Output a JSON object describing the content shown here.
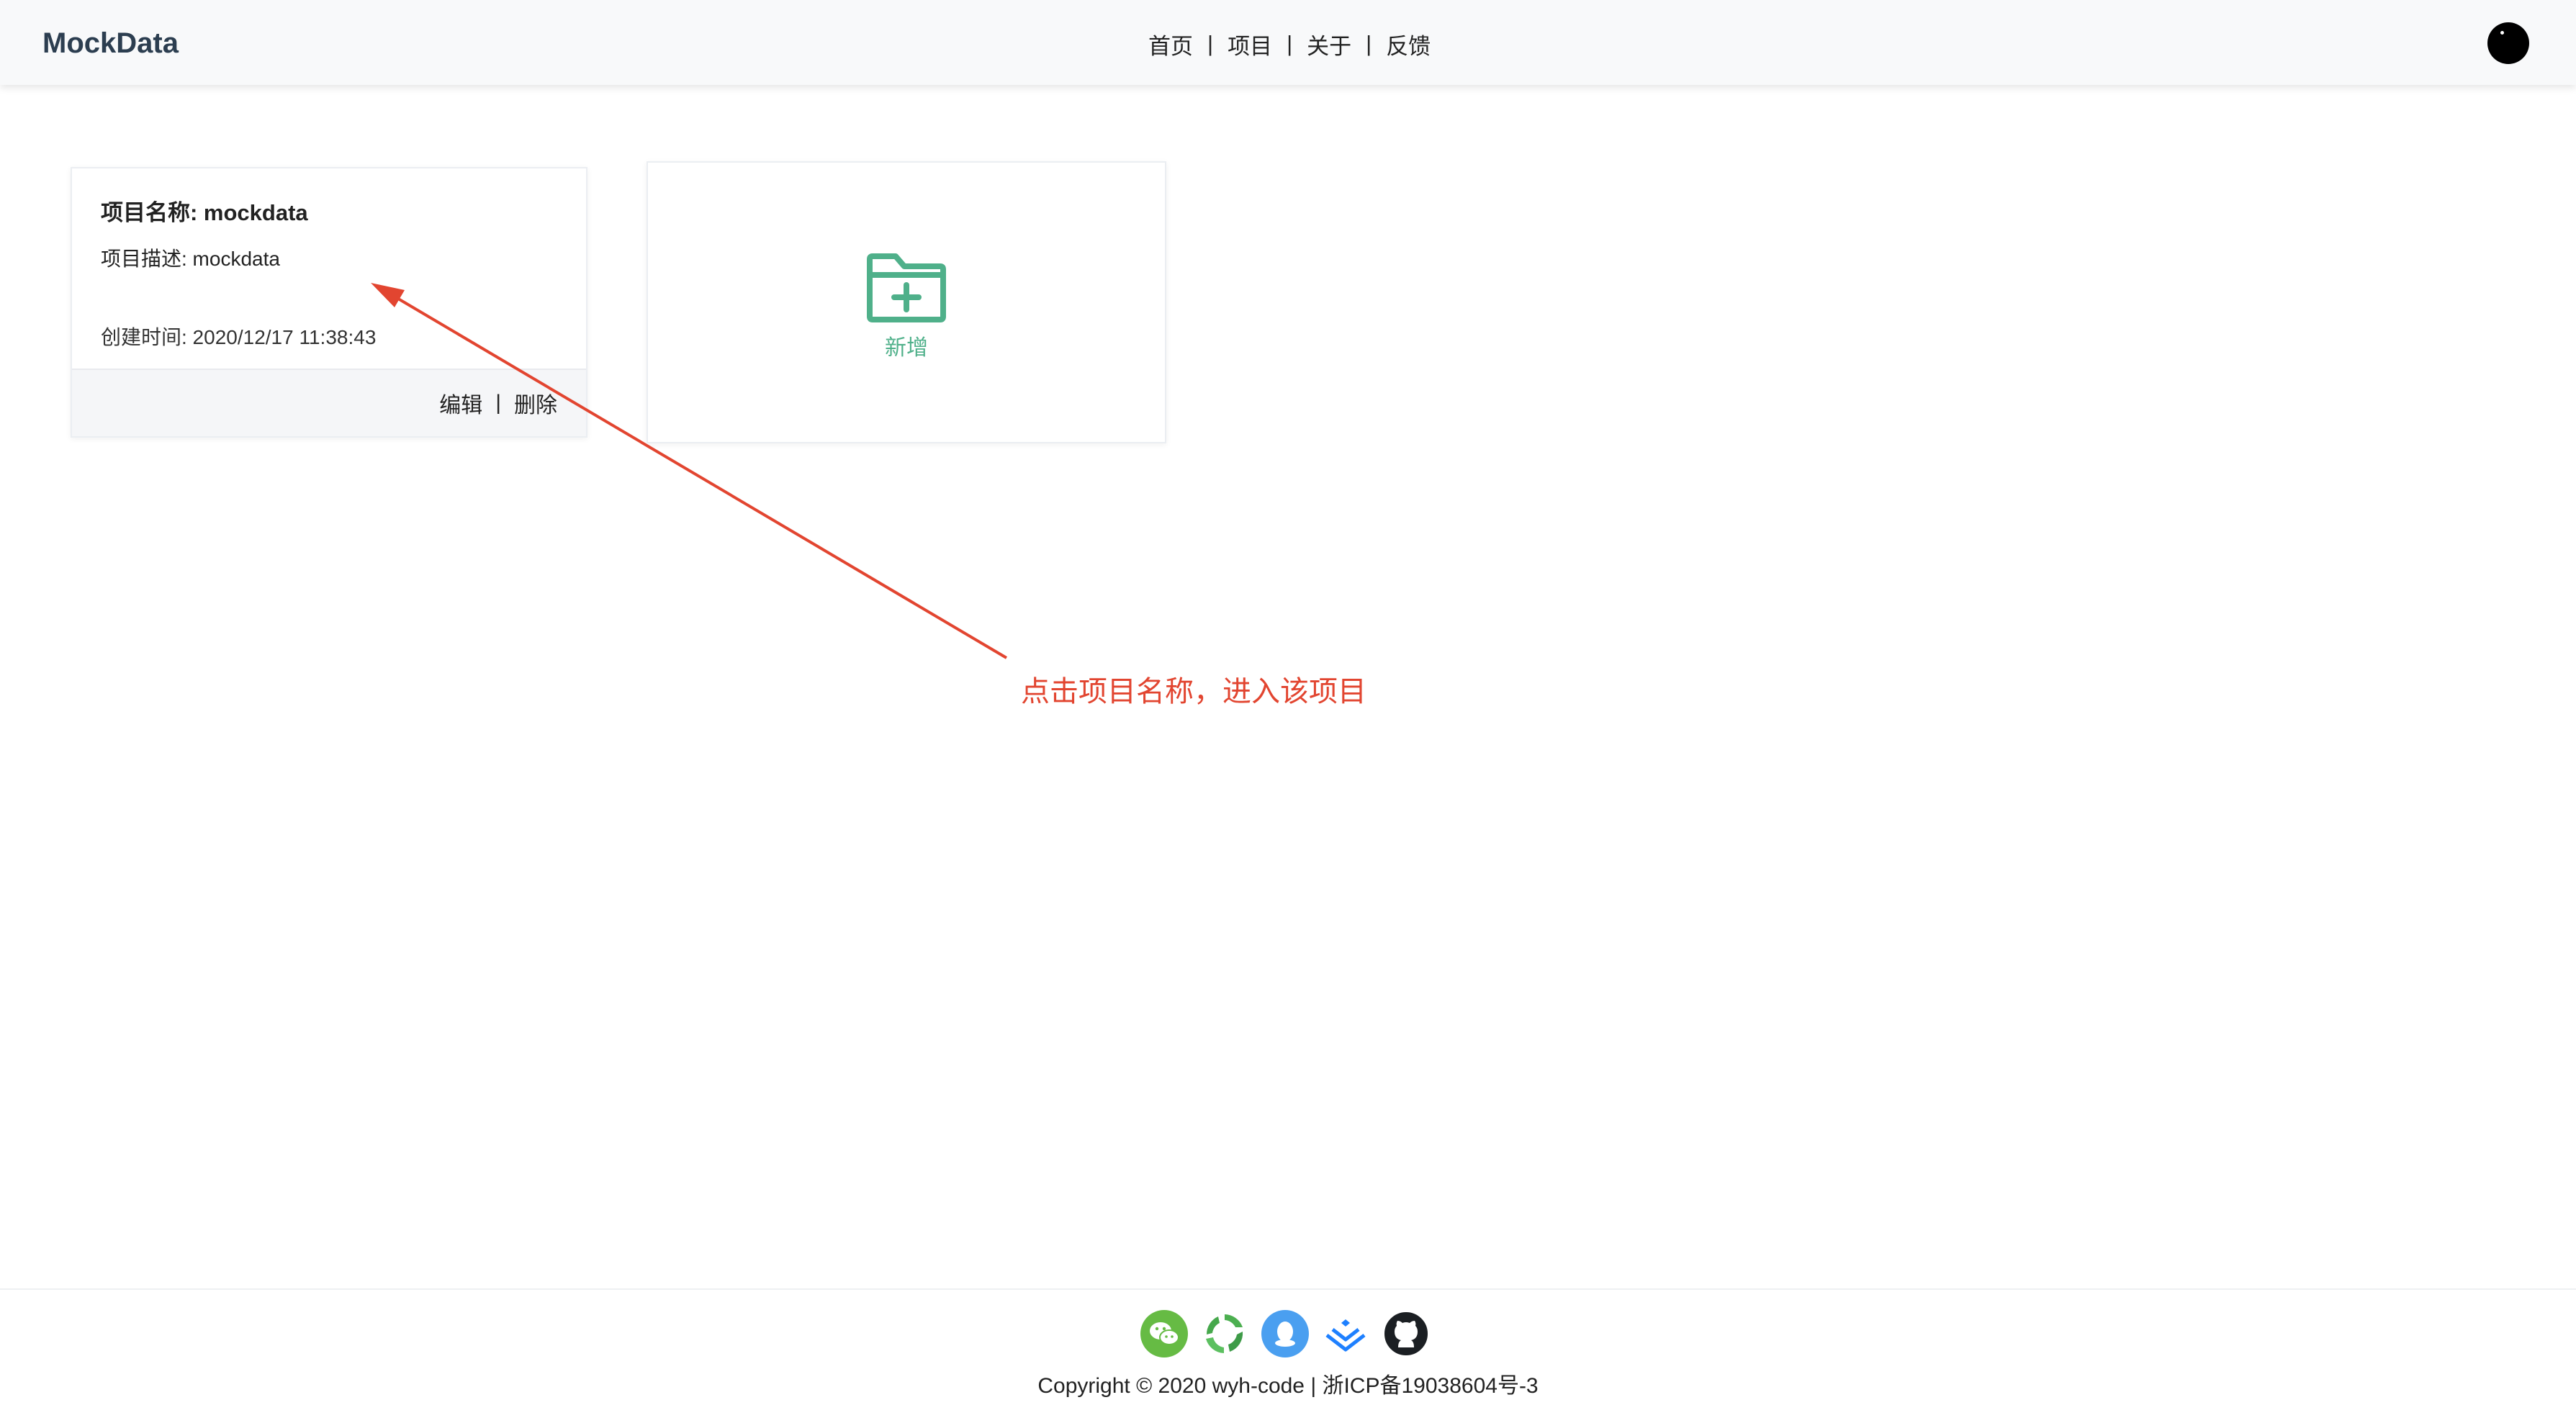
{
  "header": {
    "brand": "MockData",
    "nav": [
      {
        "label": "首页"
      },
      {
        "label": "项目"
      },
      {
        "label": "关于"
      },
      {
        "label": "反馈"
      }
    ],
    "nav_separator": "|"
  },
  "project_card": {
    "title": "项目名称: mockdata",
    "description": "项目描述: mockdata",
    "created": "创建时间: 2020/12/17 11:38:43",
    "edit_label": "编辑",
    "delete_label": "删除",
    "separator": "|"
  },
  "add_card": {
    "label": "新增",
    "icon": "folder-plus-icon",
    "color": "#4fb08a"
  },
  "annotation": {
    "text": "点击项目名称，进入该项目",
    "color": "#e24530"
  },
  "footer": {
    "icons": [
      "wechat-icon",
      "recycle-icon",
      "qq-icon",
      "juejin-icon",
      "github-icon"
    ],
    "copyright": "Copyright © 2020 wyh-code | 浙ICP备19038604号-3"
  }
}
